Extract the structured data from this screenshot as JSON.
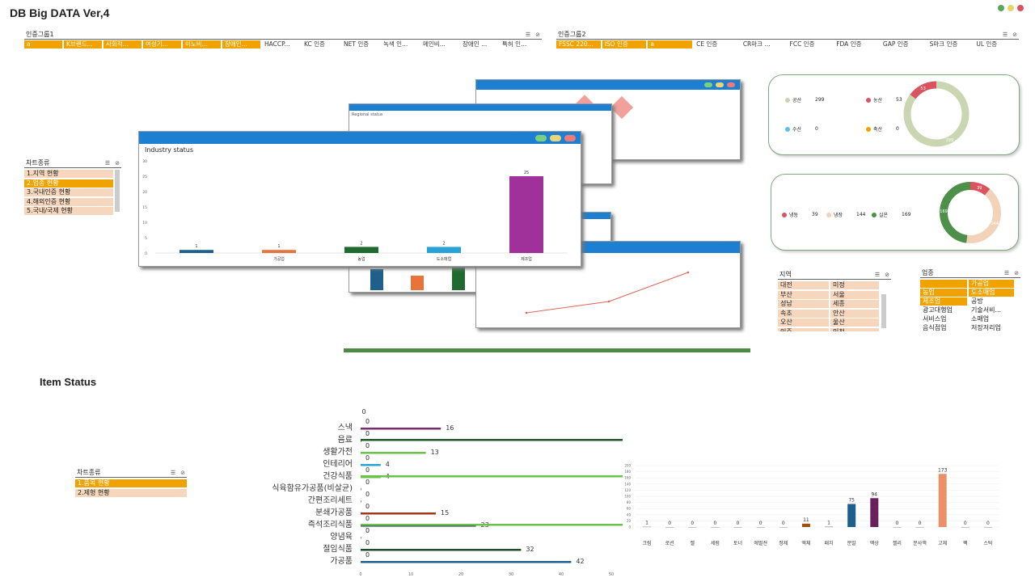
{
  "app": {
    "title": "DB Big DATA Ver,4"
  },
  "colors": {
    "accent": "#f0a300",
    "window_bar": "#1d7fd2",
    "chip_bg": "#f6d7bd"
  },
  "cert1": {
    "label": "인증그룹1",
    "chips": [
      {
        "t": "a",
        "sel": true
      },
      {
        "t": "K브랜드...",
        "sel": true
      },
      {
        "t": "사회적...",
        "sel": true
      },
      {
        "t": "여성기...",
        "sel": true
      },
      {
        "t": "이노비...",
        "sel": true
      },
      {
        "t": "장애인...",
        "sel": true
      },
      {
        "t": "HACCP...",
        "sel": false
      },
      {
        "t": "KC 인증",
        "sel": false
      },
      {
        "t": "NET 인증",
        "sel": false
      },
      {
        "t": "녹색 인...",
        "sel": false
      },
      {
        "t": "메인비...",
        "sel": false
      },
      {
        "t": "장애인 ...",
        "sel": false
      },
      {
        "t": "특허 인...",
        "sel": false
      }
    ]
  },
  "cert2": {
    "label": "인증그룹2",
    "chips": [
      {
        "t": "FSSC 220...",
        "sel": true
      },
      {
        "t": "ISO 인증",
        "sel": true
      },
      {
        "t": "a",
        "sel": true
      },
      {
        "t": "CE 인증",
        "sel": false
      },
      {
        "t": "CR마크 ...",
        "sel": false
      },
      {
        "t": "FCC 인증",
        "sel": false
      },
      {
        "t": "FDA 인증",
        "sel": false
      },
      {
        "t": "GAP 인증",
        "sel": false
      },
      {
        "t": "S마크 인증",
        "sel": false
      },
      {
        "t": "UL 인증",
        "sel": false
      }
    ]
  },
  "chartType1": {
    "label": "차트종류",
    "items": [
      {
        "t": "1.지역 현황",
        "sel": false
      },
      {
        "t": "2.업종 현황",
        "sel": true
      },
      {
        "t": "3.국내인증 현황",
        "sel": false
      },
      {
        "t": "4.해외인증 현황",
        "sel": false
      },
      {
        "t": "5.국내/국제 현황",
        "sel": false
      }
    ]
  },
  "region": {
    "label": "지역",
    "items": [
      "대전",
      "미정",
      "부산",
      "서울",
      "성남",
      "세종",
      "속초",
      "안산",
      "오산",
      "울산",
      "인주",
      "인천"
    ]
  },
  "industry": {
    "label": "업종",
    "items": [
      {
        "t": "",
        "sel": true
      },
      {
        "t": "가공업",
        "sel": true
      },
      {
        "t": "농업",
        "sel": true
      },
      {
        "t": "도소매업",
        "sel": true
      },
      {
        "t": "제조업",
        "sel": true
      },
      {
        "t": "공방",
        "sel": false
      },
      {
        "t": "광고대행업",
        "sel": false
      },
      {
        "t": "기술서비...",
        "sel": false
      },
      {
        "t": "서비스업",
        "sel": false
      },
      {
        "t": "소매업",
        "sel": false
      },
      {
        "t": "음식점업",
        "sel": false
      },
      {
        "t": "저장저리업",
        "sel": false
      }
    ]
  },
  "industryWindow": {
    "title": "Industry status"
  },
  "regionWindow": {
    "title": "Regional status"
  },
  "donut1": {
    "legend": [
      {
        "name": "공산",
        "value": "299",
        "color": "#c9d6b1"
      },
      {
        "name": "농산",
        "value": "53",
        "color": "#d9545f"
      },
      {
        "name": "수산",
        "value": "0",
        "color": "#5bc0eb"
      },
      {
        "name": "축산",
        "value": "0",
        "color": "#f0a300"
      }
    ],
    "labels": [
      "53",
      "299"
    ]
  },
  "donut2": {
    "legend": [
      {
        "name": "냉동",
        "value": "39",
        "color": "#d9545f"
      },
      {
        "name": "냉장",
        "value": "144",
        "color": "#f2d2b8"
      },
      {
        "name": "실온",
        "value": "169",
        "color": "#4e8f4a"
      }
    ],
    "labels": [
      "39",
      "144",
      "169"
    ]
  },
  "itemStatus": {
    "title": "Item Status"
  },
  "chartType2": {
    "label": "차트종류",
    "items": [
      {
        "t": "1.품목 현황",
        "sel": true
      },
      {
        "t": "2.제형 현황",
        "sel": false
      }
    ]
  },
  "chart_data": [
    {
      "type": "bar",
      "title": "Industry status",
      "categories": [
        "",
        "가공업",
        "농업",
        "도소매업",
        "제조업"
      ],
      "values": [
        1,
        1,
        2,
        2,
        25
      ],
      "ylim": [
        0,
        30
      ],
      "colors": [
        "#1f5f8b",
        "#e8743b",
        "#1f6b2f",
        "#29a3d6",
        "#a0309a"
      ]
    },
    {
      "type": "bar",
      "orientation": "horizontal",
      "categories": [
        "스낵",
        "음료",
        "생활가전",
        "인테리어",
        "건강식품",
        "식육함유가공품(비살균)",
        "간편조리세트",
        "분쇄가공품",
        "즉석조리식품",
        "양념육",
        "절임식품",
        "가공품"
      ],
      "series": [
        {
          "values": [
            16,
            0,
            13,
            4,
            4,
            0,
            0,
            15,
            23,
            0,
            32,
            42
          ]
        },
        {
          "values": [
            0,
            0,
            0,
            0,
            0,
            0,
            0,
            0,
            0,
            0,
            0,
            0
          ]
        }
      ],
      "xlim": [
        0,
        70
      ],
      "xticks": [
        0,
        10,
        20,
        30,
        40,
        50,
        60,
        70
      ]
    },
    {
      "type": "bar",
      "categories": [
        "크림",
        "로션",
        "젤",
        "세럼",
        "토너",
        "에멀젼",
        "정제",
        "액체",
        "패치",
        "분말",
        "액상",
        "젤리",
        "분사액",
        "고체",
        "팩",
        "스틱"
      ],
      "values": [
        1,
        0,
        0,
        0,
        0,
        0,
        0,
        11,
        1,
        75,
        94,
        0,
        0,
        173,
        0,
        0
      ],
      "ylim": [
        0,
        200
      ],
      "yticks": [
        0,
        20,
        40,
        60,
        80,
        100,
        120,
        140,
        160,
        180,
        200
      ]
    },
    {
      "type": "pie",
      "title": "donut1",
      "categories": [
        "공산",
        "농산",
        "수산",
        "축산"
      ],
      "values": [
        299,
        53,
        0,
        0
      ]
    },
    {
      "type": "pie",
      "title": "donut2",
      "categories": [
        "냉동",
        "냉장",
        "실온"
      ],
      "values": [
        39,
        144,
        169
      ]
    }
  ]
}
